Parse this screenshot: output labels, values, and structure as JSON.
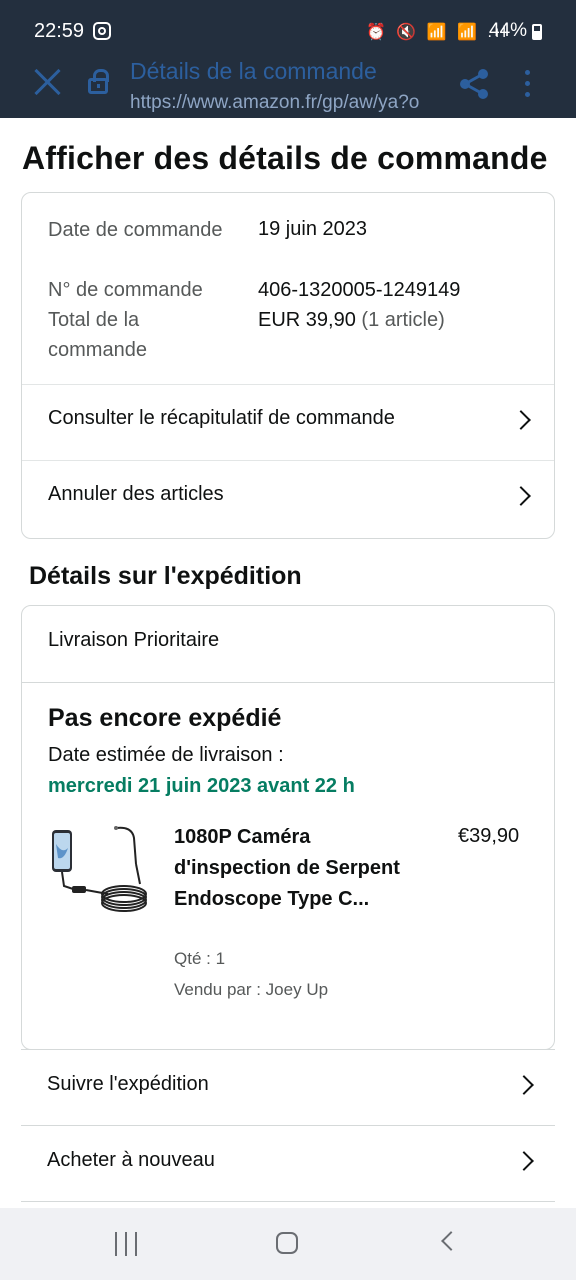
{
  "status_bar": {
    "time": "22:59",
    "system_icons": "⏰ 🔇 📶 📶 .ıl",
    "battery": "44%"
  },
  "tab_header": {
    "title": "Détails de la commande",
    "url": "https://www.amazon.fr/gp/aw/ya?o"
  },
  "page": {
    "title": "Afficher des détails de commande"
  },
  "order_summary": {
    "date_label": "Date de commande",
    "date_value": "19 juin 2023",
    "number_label": "N° de commande",
    "number_value": "406-1320005-1249149",
    "total_label": "Total de la commande",
    "total_value": "EUR 39,90",
    "total_count": "(1 article)",
    "rows": [
      {
        "label": "Consulter le récapitulatif de commande"
      },
      {
        "label": "Annuler des articles"
      }
    ]
  },
  "shipping": {
    "section_title": "Détails sur l'expédition",
    "method": "Livraison Prioritaire",
    "status": "Pas encore expédié",
    "estimate_label": "Date estimée de livraison :",
    "estimate_date": "mercredi 21 juin 2023 avant 22 h",
    "item": {
      "name": "1080P Caméra d'inspection de Serpent Endoscope Type C...",
      "price": "€39,90",
      "quantity": "Qté : 1",
      "seller": "Vendu par : Joey Up"
    }
  },
  "actions": [
    {
      "label": "Suivre l'expédition"
    },
    {
      "label": "Acheter à nouveau"
    }
  ],
  "colors": {
    "header_bg": "#232f3e",
    "header_accent": "#2c5f9e",
    "delivery_green": "#067d62"
  }
}
